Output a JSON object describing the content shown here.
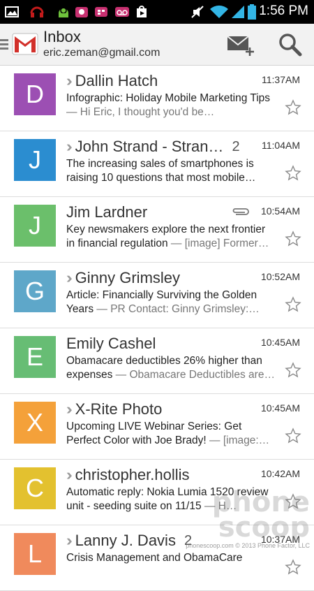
{
  "status_bar": {
    "time": "1:56 PM",
    "icons": [
      "image-icon",
      "headset-icon",
      "android-icon",
      "app-icon",
      "bbm-icon",
      "voicemail-icon",
      "play-store-icon",
      "mute-icon",
      "wifi-icon",
      "signal-icon",
      "battery-icon"
    ]
  },
  "header": {
    "title": "Inbox",
    "account": "eric.zeman@gmail.com",
    "compose_icon": "compose-mail-icon",
    "search_icon": "search-icon"
  },
  "emails": [
    {
      "initial": "D",
      "color": "#9c4fb3",
      "sender": "Dallin Hatch",
      "count": "",
      "has_chevron": true,
      "has_attachment": false,
      "time": "11:37AM",
      "subject": "Infographic: Holiday Mobile Marketing Tips",
      "preview": " — Hi Eric, I thought you'd be…"
    },
    {
      "initial": "J",
      "color": "#2b8dd0",
      "sender": "John Strand - Stran…",
      "count": "2",
      "has_chevron": true,
      "has_attachment": false,
      "time": "11:04AM",
      "subject": "The increasing sales of smartphones is raising 10 questions that most mobile…",
      "preview": ""
    },
    {
      "initial": "J",
      "color": "#6bbf6b",
      "sender": "Jim Lardner",
      "count": "",
      "has_chevron": false,
      "has_attachment": true,
      "time": "10:54AM",
      "subject": "Key newsmakers explore the next frontier in financial regulation",
      "preview": " — [image] Former…"
    },
    {
      "initial": "G",
      "color": "#5ea7c9",
      "sender": "Ginny Grimsley",
      "count": "",
      "has_chevron": true,
      "has_attachment": false,
      "time": "10:52AM",
      "subject": "Article: Financially Surviving the Golden Years",
      "preview": " — PR Contact: Ginny Grimsley:…"
    },
    {
      "initial": "E",
      "color": "#67bd74",
      "sender": "Emily Cashel",
      "count": "",
      "has_chevron": false,
      "has_attachment": false,
      "time": "10:45AM",
      "subject": "Obamacare deductibles 26% higher than expenses",
      "preview": " — Obamacare Deductibles are…"
    },
    {
      "initial": "X",
      "color": "#f4a13a",
      "sender": "X-Rite Photo",
      "count": "",
      "has_chevron": true,
      "has_attachment": false,
      "time": "10:45AM",
      "subject": "Upcoming LIVE Webinar Series: Get Perfect Color with Joe Brady!",
      "preview": " — [image:…"
    },
    {
      "initial": "C",
      "color": "#e3c12f",
      "sender": "christopher.hollis",
      "count": "",
      "has_chevron": true,
      "has_attachment": false,
      "time": "10:42AM",
      "subject": "Automatic reply: Nokia Lumia 1520 review unit - seeding suite on 11/15",
      "preview": " — H…"
    },
    {
      "initial": "L",
      "color": "#f08a5c",
      "sender": "Lanny J. Davis",
      "count": "2",
      "has_chevron": true,
      "has_attachment": false,
      "time": "10:37AM",
      "subject": "Crisis Management and ObamaCare",
      "preview": ""
    }
  ],
  "watermark": {
    "line1": "phone",
    "line2": "scoop",
    "small": "phonescoop.com © 2013 Phone Factor, LLC"
  }
}
